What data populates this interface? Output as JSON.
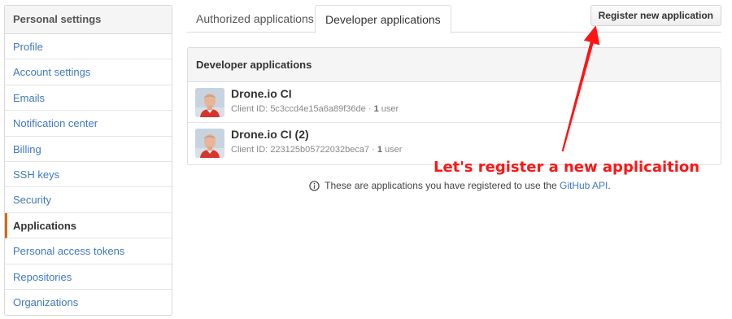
{
  "sidebar": {
    "title": "Personal settings",
    "items": [
      {
        "label": "Profile"
      },
      {
        "label": "Account settings"
      },
      {
        "label": "Emails"
      },
      {
        "label": "Notification center"
      },
      {
        "label": "Billing"
      },
      {
        "label": "SSH keys"
      },
      {
        "label": "Security"
      },
      {
        "label": "Applications",
        "selected": true
      },
      {
        "label": "Personal access tokens"
      },
      {
        "label": "Repositories"
      },
      {
        "label": "Organizations"
      }
    ]
  },
  "tabs": {
    "authorized": "Authorized applications",
    "developer": "Developer applications",
    "active": "developer"
  },
  "register_button": "Register new application",
  "apps": {
    "header": "Developer applications",
    "items": [
      {
        "name": "Drone.io CI",
        "client_id_label": "Client ID:",
        "client_id": "5c3ccd4e15a6a89f36de",
        "separator": "·",
        "users_count": "1",
        "users_label": "user"
      },
      {
        "name": "Drone.io CI (2)",
        "client_id_label": "Client ID:",
        "client_id": "223125b05722032beca7",
        "separator": "·",
        "users_count": "1",
        "users_label": "user"
      }
    ]
  },
  "note": {
    "text": "These are applications you have registered to use the",
    "link": "GitHub API",
    "suffix": "."
  },
  "annotation": {
    "text": "Let's register a new applicaition",
    "color": "#ff1515"
  },
  "colors": {
    "link": "#4078c0",
    "selected_accent": "#d26911"
  }
}
